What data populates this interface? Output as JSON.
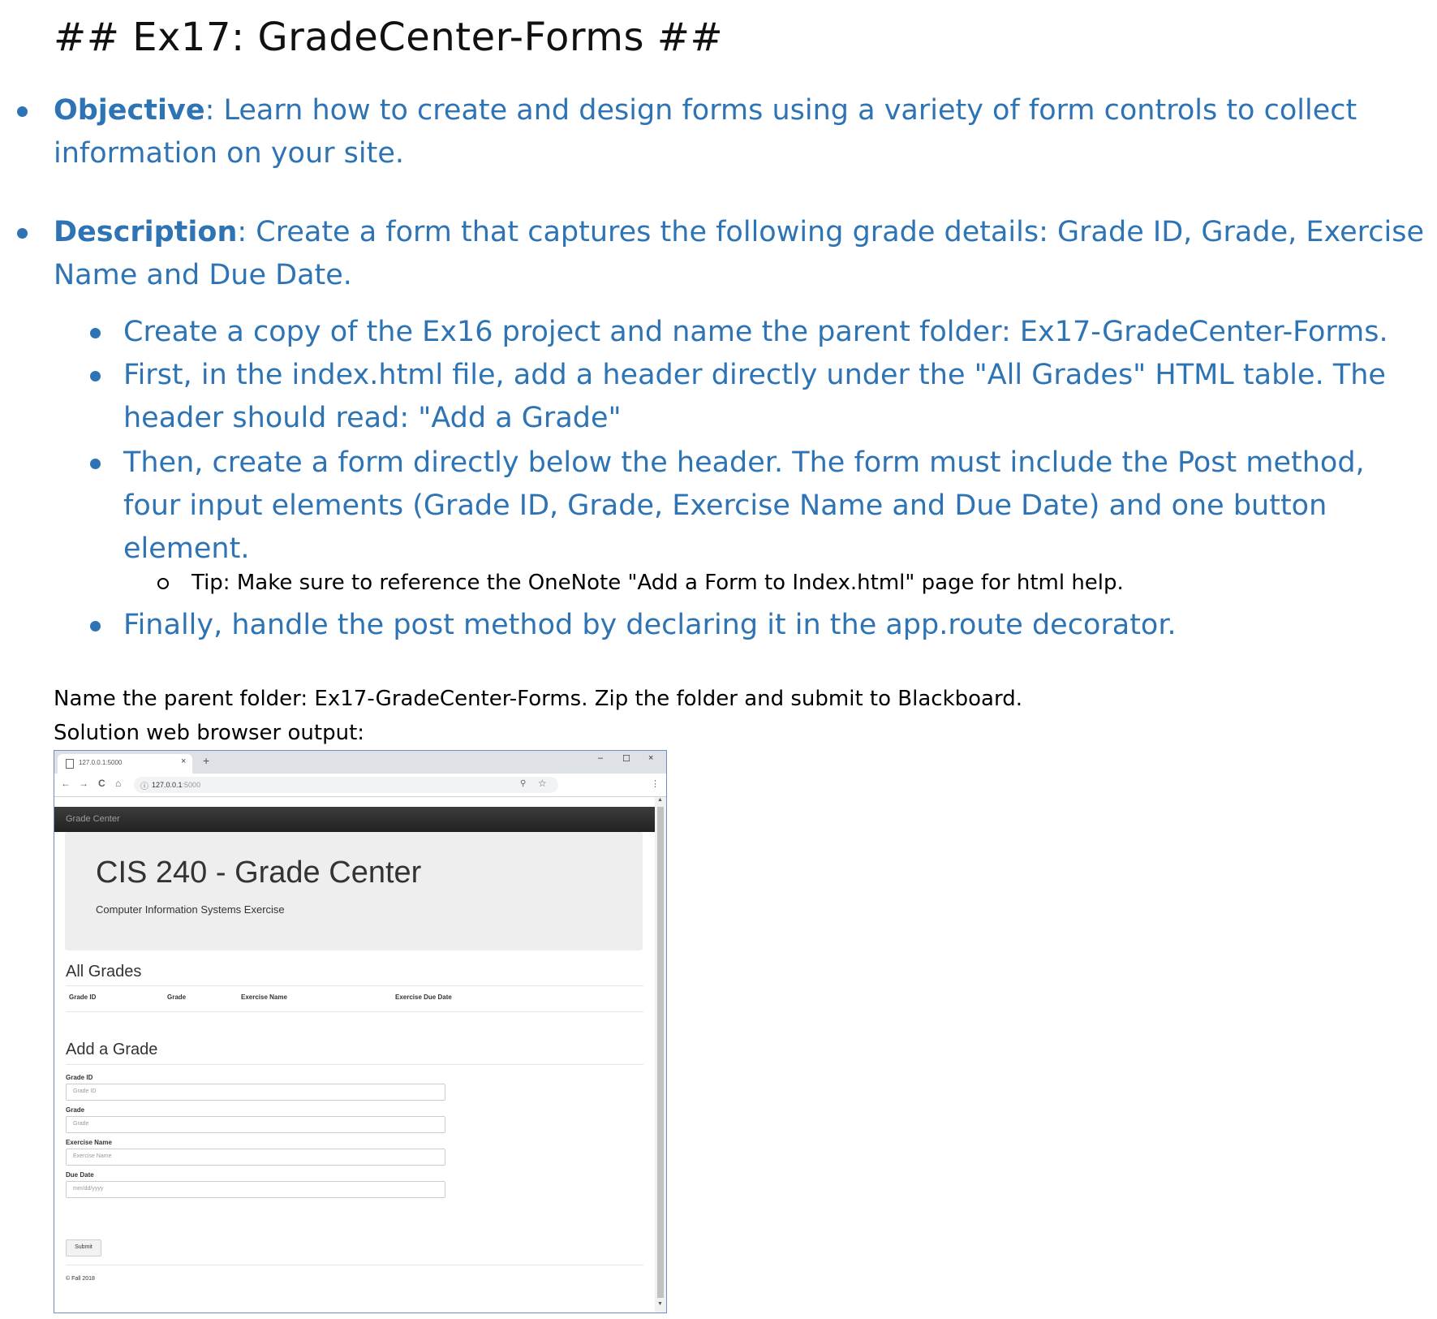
{
  "doc": {
    "title": "## Ex17: GradeCenter-Forms ##",
    "objective_label": "Objective",
    "objective_text": ": Learn how to create and design forms using a variety of form controls to collect information on your site.",
    "description_label": "Description",
    "description_text": ": Create a form that captures the following grade details: Grade ID, Grade, Exercise Name and Due Date.",
    "steps": [
      "Create a copy of the Ex16 project and name the parent folder: Ex17-GradeCenter-Forms.",
      "First, in the index.html file, add a header directly under the \"All Grades\" HTML table. The header should read: \"Add a Grade\"",
      "Then, create a form directly below the header. The form must include the Post method, four input elements (Grade ID, Grade, Exercise Name and Due Date) and one button element.",
      "Finally, handle the post method by declaring it in the app.route decorator."
    ],
    "tip": "Tip: Make sure to reference the OneNote \"Add a Form to Index.html\" page for html help.",
    "submit_note": "Name the parent folder: Ex17-GradeCenter-Forms.  Zip the folder and submit to Blackboard.",
    "solution_label": "Solution web browser output:"
  },
  "browser": {
    "tab_title": "127.0.0.1:5000",
    "tab_close": "×",
    "new_tab": "+",
    "minimize": "–",
    "maximize": "☐",
    "close": "×",
    "back": "←",
    "forward": "→",
    "reload": "C",
    "home": "⌂",
    "info": "ⓘ",
    "url_host": "127.0.0.1",
    "url_port": ":5000",
    "zoom": "⚲",
    "star": "☆",
    "menu": "⋮",
    "page": {
      "brand": "Grade Center",
      "heading": "CIS 240 - Grade Center",
      "subheading": "Computer Information Systems Exercise",
      "all_grades_title": "All Grades",
      "table_headers": [
        "Grade ID",
        "Grade",
        "Exercise Name",
        "Exercise Due Date"
      ],
      "add_grade_title": "Add a Grade",
      "fields": [
        {
          "label": "Grade ID",
          "placeholder": "Grade ID"
        },
        {
          "label": "Grade",
          "placeholder": "Grade"
        },
        {
          "label": "Exercise Name",
          "placeholder": "Exercise Name"
        },
        {
          "label": "Due Date",
          "placeholder": "mm/dd/yyyy"
        }
      ],
      "submit_label": "Submit",
      "footer": "© Fall 2018"
    }
  },
  "colors": {
    "accent": "#2e74b5",
    "navbar": "#222222",
    "jumbotron": "#eeeeee"
  }
}
